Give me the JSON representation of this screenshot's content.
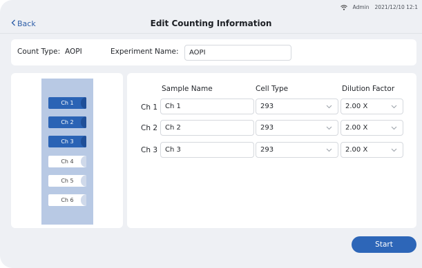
{
  "status_bar": {
    "user": "Admin",
    "datetime": "2021/12/10 12:1"
  },
  "header": {
    "back_label": "Back",
    "title": "Edit Counting Information"
  },
  "info": {
    "count_type_label": "Count Type:",
    "count_type_value": "AOPI",
    "experiment_name_label": "Experiment Name:",
    "experiment_name_value": "AOPI"
  },
  "slide": {
    "channels": [
      {
        "label": "Ch 1",
        "selected": true
      },
      {
        "label": "Ch 2",
        "selected": true
      },
      {
        "label": "Ch 3",
        "selected": true
      },
      {
        "label": "Ch 4",
        "selected": false
      },
      {
        "label": "Ch 5",
        "selected": false
      },
      {
        "label": "Ch 6",
        "selected": false
      }
    ]
  },
  "table": {
    "headers": {
      "sample_name": "Sample Name",
      "cell_type": "Cell Type",
      "dilution_factor": "Dilution Factor"
    },
    "rows": [
      {
        "channel": "Ch 1",
        "sample_name": "Ch 1",
        "cell_type": "293",
        "dilution_factor": "2.00 X"
      },
      {
        "channel": "Ch 2",
        "sample_name": "Ch 2",
        "cell_type": "293",
        "dilution_factor": "2.00 X"
      },
      {
        "channel": "Ch 3",
        "sample_name": "Ch 3",
        "cell_type": "293",
        "dilution_factor": "2.00 X"
      }
    ]
  },
  "actions": {
    "start_label": "Start"
  },
  "colors": {
    "accent": "#2d66b8",
    "selected_channel": "#2a63b5",
    "slide_bg": "#b8c9e4",
    "back_link": "#2f5fa8"
  }
}
